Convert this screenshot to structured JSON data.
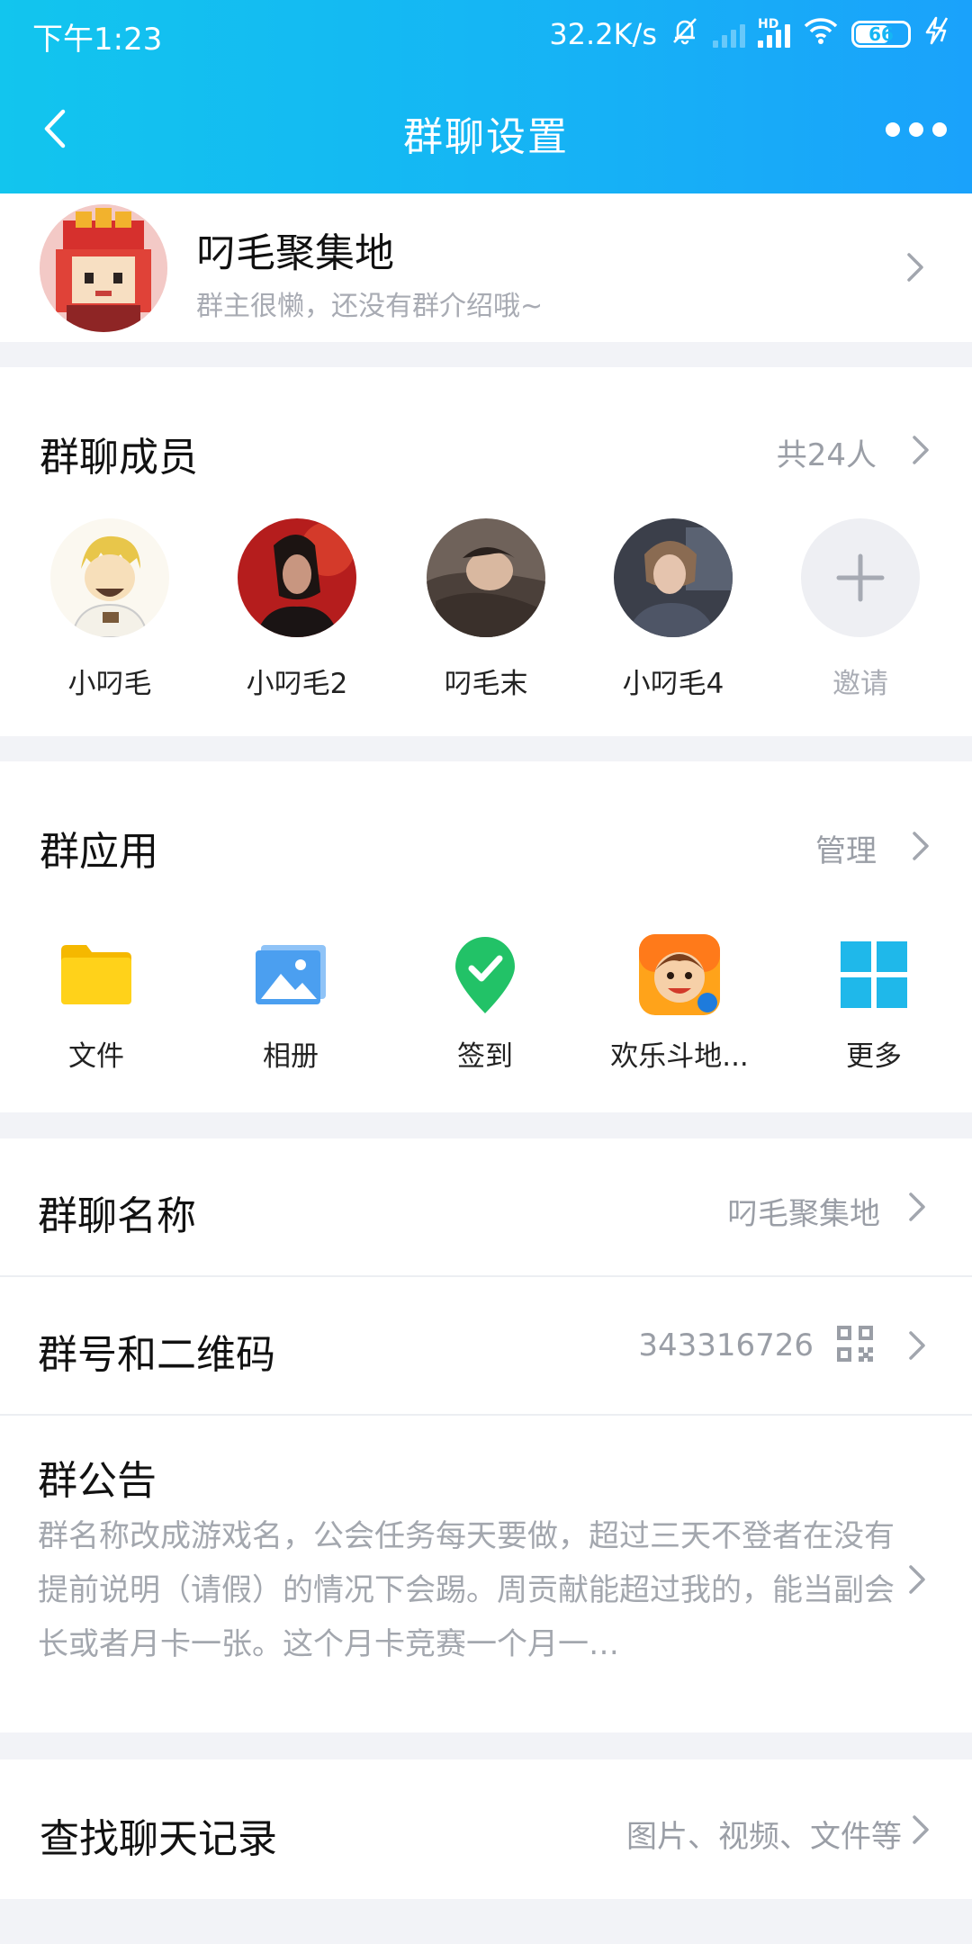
{
  "status_bar": {
    "time": "下午1:23",
    "speed": "32.2K/s",
    "battery": "66"
  },
  "nav": {
    "title": "群聊设置"
  },
  "group": {
    "name": "叼毛聚集地",
    "intro": "群主很懒，还没有群介绍哦~"
  },
  "members": {
    "title": "群聊成员",
    "count": "共24人",
    "list": [
      {
        "name": "小叼毛"
      },
      {
        "name": "小叼毛2"
      },
      {
        "name": "叼毛末"
      },
      {
        "name": "小叼毛4"
      }
    ],
    "invite_label": "邀请"
  },
  "apps": {
    "title": "群应用",
    "manage": "管理",
    "list": [
      {
        "name": "文件",
        "icon": "folder-icon"
      },
      {
        "name": "相册",
        "icon": "album-icon"
      },
      {
        "name": "签到",
        "icon": "checkin-icon"
      },
      {
        "name": "欢乐斗地...",
        "icon": "game-icon"
      },
      {
        "name": "更多",
        "icon": "grid-icon"
      }
    ]
  },
  "settings": {
    "group_name_label": "群聊名称",
    "group_name_value": "叼毛聚集地",
    "group_id_label": "群号和二维码",
    "group_id_value": "343316726",
    "notice_label": "群公告",
    "notice_text": "群名称改成游戏名，公会任务每天要做，超过三天不登者在没有提前说明（请假）的情况下会踢。周贡献能超过我的，能当副会长或者月卡一张。这个月卡竞赛一个月一…"
  },
  "search": {
    "label": "查找聊天记录",
    "hint": "图片、视频、文件等"
  },
  "colors": {
    "header_start": "#12c5ee",
    "header_end": "#1aa2fb",
    "background": "#f2f3f7",
    "secondary_text": "#9a9ea6"
  }
}
